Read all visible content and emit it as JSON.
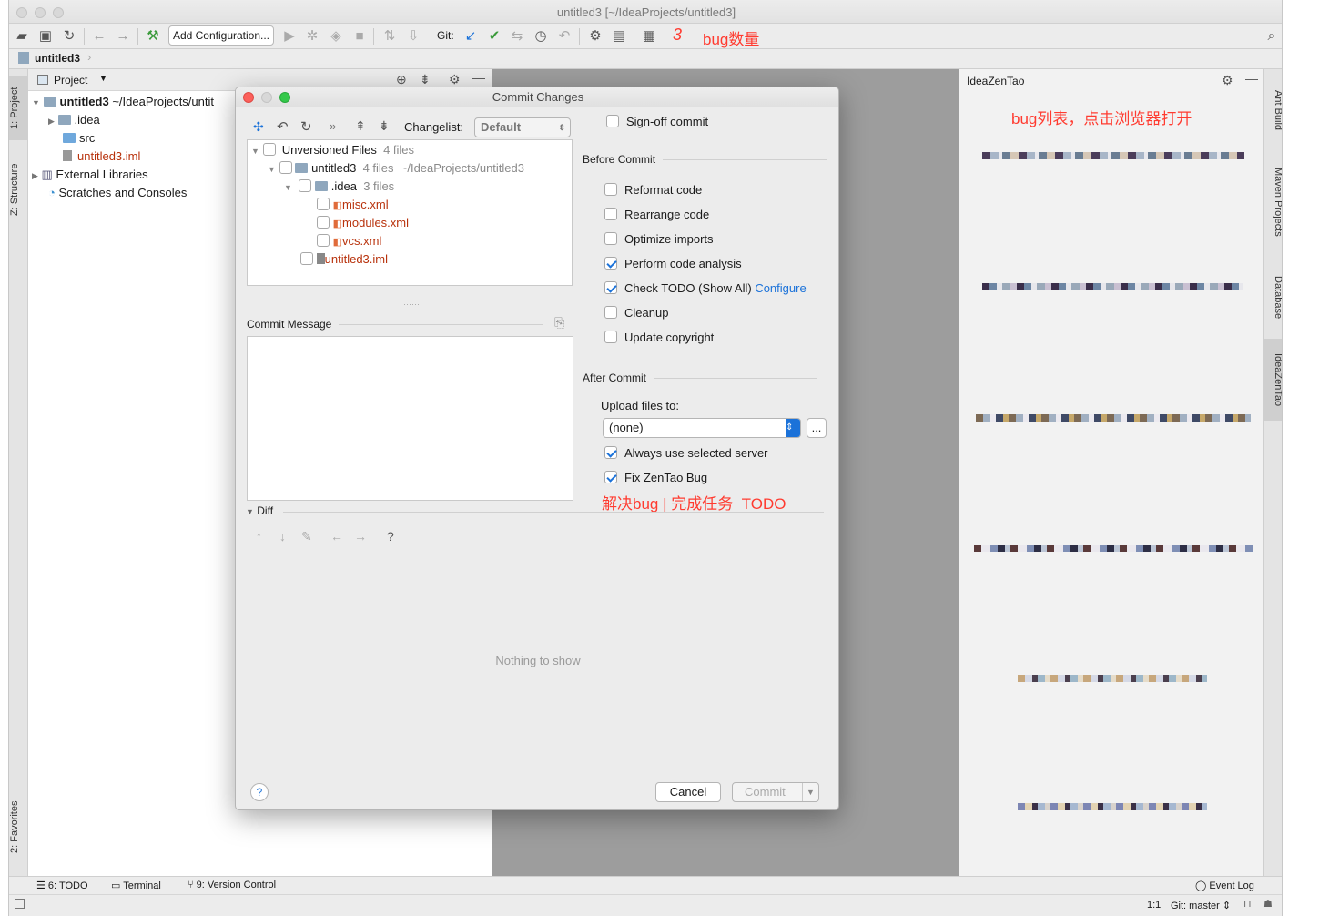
{
  "window": {
    "title": "untitled3 [~/IdeaProjects/untitled3]"
  },
  "toolbar": {
    "add_config": "Add Configuration...",
    "git_label": "Git:",
    "bug_count": "3",
    "bug_count_label": "bug数量"
  },
  "nav": {
    "breadcrumb": "untitled3"
  },
  "left_tabs": {
    "project": "1: Project",
    "structure": "Z: Structure",
    "favorites": "2: Favorites"
  },
  "project": {
    "header": "Project",
    "root": "untitled3",
    "root_path": "~/IdeaProjects/untit",
    "items": [
      ".idea",
      "src",
      "untitled3.iml",
      "External Libraries",
      "Scratches and Consoles"
    ]
  },
  "zentao": {
    "title": "IdeaZenTao",
    "annotation": "bug列表，点击浏览器打开"
  },
  "right_tabs": {
    "ant": "Ant Build",
    "maven": "Maven Projects",
    "database": "Database",
    "zentao": "IdeaZenTao"
  },
  "dialog": {
    "title": "Commit Changes",
    "changelist_label": "Changelist:",
    "changelist_value": "Default",
    "tree": {
      "unversioned": "Unversioned Files",
      "unversioned_count": "4 files",
      "project": "untitled3",
      "project_count": "4 files",
      "project_path": "~/IdeaProjects/untitled3",
      "idea": ".idea",
      "idea_count": "3 files",
      "files": [
        "misc.xml",
        "modules.xml",
        "vcs.xml",
        "untitled3.iml"
      ]
    },
    "commit_message_label": "Commit Message",
    "signoff": "Sign-off commit",
    "before_commit": "Before Commit",
    "before_options": [
      {
        "label": "Reformat code",
        "checked": false
      },
      {
        "label": "Rearrange code",
        "checked": false
      },
      {
        "label": "Optimize imports",
        "checked": false
      },
      {
        "label": "Perform code analysis",
        "checked": true
      },
      {
        "label": "Check TODO (Show All)",
        "checked": true
      },
      {
        "label": "Cleanup",
        "checked": false
      },
      {
        "label": "Update copyright",
        "checked": false
      }
    ],
    "configure_link": "Configure",
    "after_commit": "After Commit",
    "upload_label": "Upload files to:",
    "upload_value": "(none)",
    "browse": "...",
    "always_server": "Always use selected server",
    "fix_zentao": "Fix ZenTao Bug",
    "fix_annotation": "解决bug | 完成任务  TODO",
    "diff_label": "Diff",
    "nothing": "Nothing to show",
    "help": "?",
    "cancel": "Cancel",
    "commit": "Commit"
  },
  "bottom": {
    "todo": "6: TODO",
    "terminal": "Terminal",
    "vcs": "9: Version Control",
    "event_log": "Event Log"
  },
  "status": {
    "position": "1:1",
    "git": "Git: master"
  },
  "colors": {
    "accent": "#1b72d9",
    "annotation": "#ff3b30",
    "editor_bg": "#9d9d9d"
  }
}
